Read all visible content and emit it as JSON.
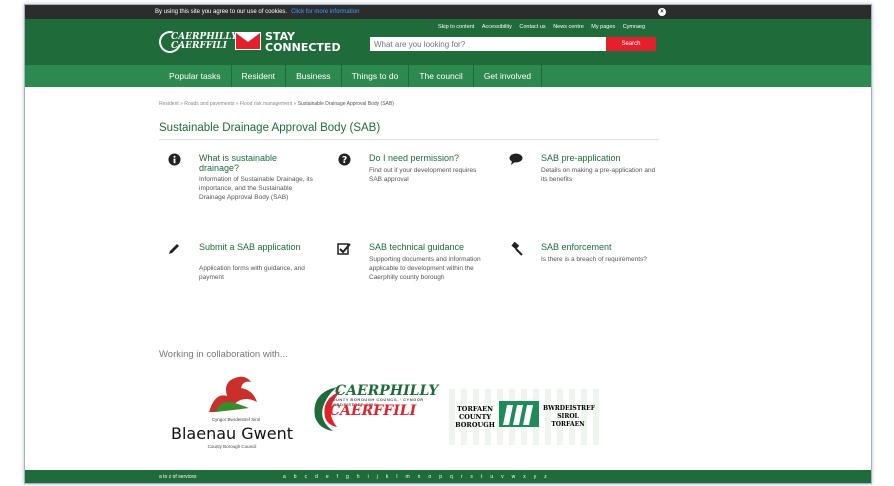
{
  "cookie": {
    "text": "By using this site you agree to our use of cookies.",
    "link": "Click for more information"
  },
  "header": {
    "top_links": [
      "Skip to content",
      "Accessibility",
      "Contact us",
      "News centre",
      "My pages",
      "Cymraeg"
    ],
    "logo_line1": "CAERPHILLY",
    "logo_line2": "CAERFFILI",
    "stay1": "STAY",
    "stay2": "CONNECTED",
    "search_placeholder": "What are you looking for?",
    "search_button": "Search"
  },
  "nav": [
    "Popular tasks",
    "Resident",
    "Business",
    "Things to do",
    "The council",
    "Get involved"
  ],
  "breadcrumb": [
    "Resident",
    "Roads and pavements",
    "Flood risk management",
    "Sustainable Drainage Approval Body (SAB)"
  ],
  "page_title": "Sustainable Drainage Approval Body (SAB)",
  "cards": [
    {
      "icon": "info-icon",
      "title": "What is sustainable drainage?",
      "desc": "Information of Sustainable Drainage, its importance, and the Sustainable Drainage Approval Body (SAB)"
    },
    {
      "icon": "question-icon",
      "title": "Do I need permission?",
      "desc": "Find out if your development requires SAB approval"
    },
    {
      "icon": "comment-icon",
      "title": "SAB pre-application",
      "desc": "Details on making a pre-application and its benefits"
    },
    {
      "icon": "pencil-icon",
      "title": "Submit a SAB application",
      "desc": "Application forms with guidance, and payment"
    },
    {
      "icon": "checkbox-icon",
      "title": "SAB technical guidance",
      "desc": "Supporting documents and information applicable to development within the Caerphilly county borough"
    },
    {
      "icon": "gavel-icon",
      "title": "SAB enforcement",
      "desc": "Is there is a breach of requirements?"
    }
  ],
  "collab_heading": "Working in collaboration with...",
  "partners": {
    "blaenau": {
      "line1": "Cyngor Bwrdeistref Sirol",
      "name": "Blaenau Gwent",
      "line3": "County Borough Council"
    },
    "caerphilly": {
      "name": "CAERPHILLY",
      "sub": "COUNTY BOROUGH COUNCIL · CYNGOR BWRDEISTREF SIROL",
      "welsh": "CAERFFILI"
    },
    "torfaen": {
      "left": "TORFAEN COUNTY BOROUGH",
      "right": "BWRDEISTREF SIROL TORFAEN"
    }
  },
  "footer": {
    "az": "a to z of services",
    "letters": [
      "a",
      "b",
      "c",
      "d",
      "e",
      "f",
      "g",
      "h",
      "i",
      "j",
      "k",
      "l",
      "m",
      "n",
      "o",
      "p",
      "q",
      "r",
      "s",
      "t",
      "u",
      "v",
      "w",
      "x",
      "y",
      "z"
    ]
  },
  "colors": {
    "dark_green": "#1f6b3a",
    "nav_green": "#2d8a4e",
    "red": "#e4202d"
  }
}
